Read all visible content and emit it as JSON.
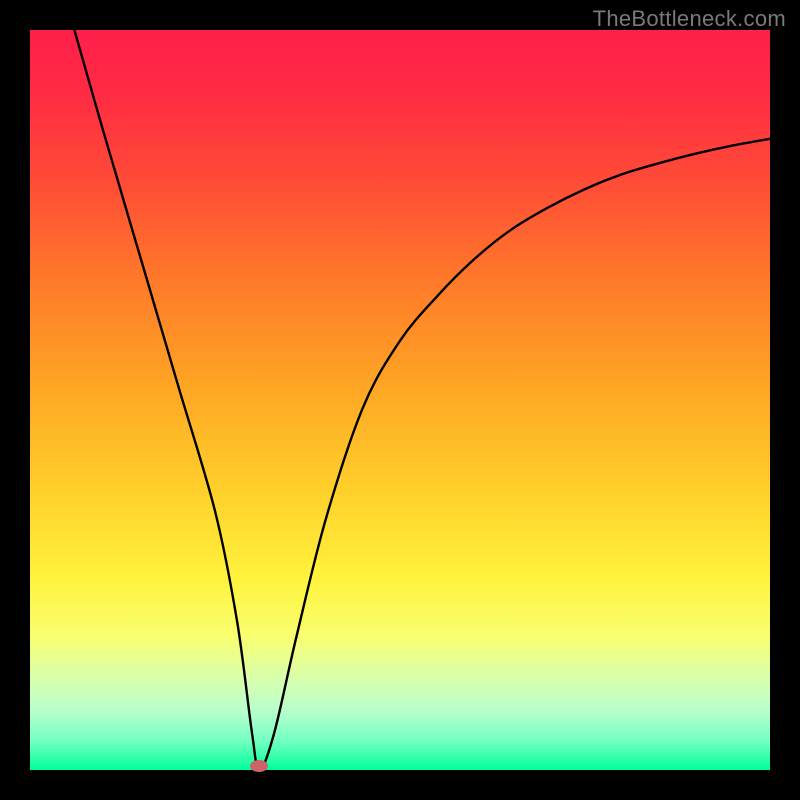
{
  "watermark": "TheBottleneck.com",
  "chart_data": {
    "type": "line",
    "title": "",
    "xlabel": "",
    "ylabel": "",
    "xlim": [
      0,
      100
    ],
    "ylim": [
      0,
      100
    ],
    "grid": false,
    "legend": false,
    "series": [
      {
        "name": "curve",
        "x": [
          6,
          10,
          15,
          20,
          25,
          28,
          30,
          31,
          33,
          36,
          40,
          45,
          50,
          55,
          60,
          65,
          70,
          75,
          80,
          85,
          90,
          95,
          100
        ],
        "values": [
          100,
          86,
          69,
          52,
          35,
          20,
          5,
          0,
          5,
          18,
          34,
          49,
          58,
          64,
          69,
          73,
          76,
          78.5,
          80.5,
          82,
          83.3,
          84.4,
          85.3
        ]
      }
    ],
    "marker": {
      "x": 31,
      "y": 0.5,
      "color": "#cb6464"
    }
  },
  "colors": {
    "frame": "#000000",
    "gradient_top": "#ff1f4b",
    "gradient_bottom": "#00ff99",
    "curve": "#000000",
    "marker": "#cb6464",
    "watermark": "#7a7a7a"
  }
}
